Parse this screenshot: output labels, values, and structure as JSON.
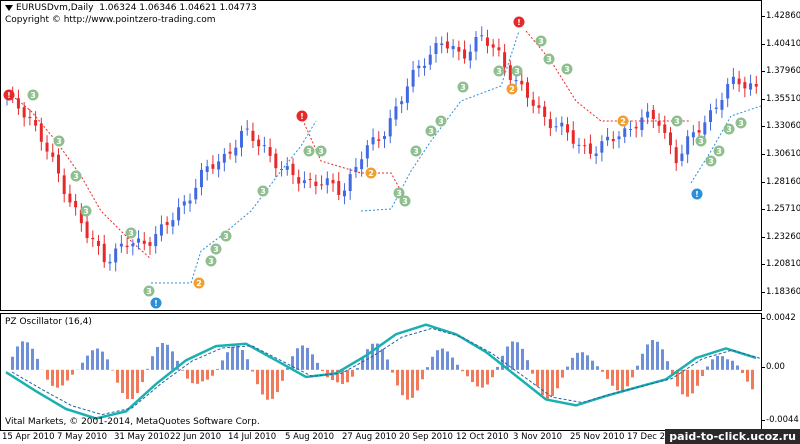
{
  "header": {
    "symbol": "EURUSDvm,Daily",
    "ohlc": "1.06324 1.06346 1.04621 1.04773",
    "copyright": "Copyright © http://www.pointzero-trading.com"
  },
  "main_axis": [
    "1.42860",
    "1.40410",
    "1.37960",
    "1.35510",
    "1.33060",
    "1.30610",
    "1.28160",
    "1.25710",
    "1.23260",
    "1.20810",
    "1.18360"
  ],
  "oscillator": {
    "title": "PZ Oscillator (16,4)",
    "axis": [
      "0.0042",
      "0.00",
      "-0.0044"
    ],
    "footer": "Vital Markets, © 2001-2014, MetaQuotes Software Corp."
  },
  "date_axis": [
    "15 Apr 2010",
    "7 May 2010",
    "31 May 2010",
    "22 Jun 2010",
    "14 Jul 2010",
    "5 Aug 2010",
    "27 Aug 2010",
    "20 Sep 2010",
    "12 Oct 2010",
    "3 Nov 2010",
    "25 Nov 2010",
    "17 Dec 2010"
  ],
  "watermark": "paid-to-click.ucoz.ru",
  "colors": {
    "bull": "#4169e1",
    "bear": "#e8292b",
    "trail_down": "#e8292b",
    "trail_up": "#2b8fd9",
    "marker_red": "#e8292b",
    "marker_blue": "#2b8fd9",
    "marker_orange": "#f0a030",
    "marker_green": "#8fbf8f",
    "osc_line": "#1ab0b0",
    "osc_pos": "#6f8fd8",
    "osc_neg": "#f07a5a"
  },
  "markers": {
    "sell": "!",
    "buy": "!",
    "wave2": "2",
    "wave3": "3"
  },
  "chart_data": {
    "type": "candlestick",
    "x": [
      "15 Apr 2010",
      "7 May 2010",
      "31 May 2010",
      "22 Jun 2010",
      "14 Jul 2010",
      "5 Aug 2010",
      "27 Aug 2010",
      "20 Sep 2010",
      "12 Oct 2010",
      "3 Nov 2010",
      "25 Nov 2010",
      "17 Dec 2010"
    ],
    "close_path": [
      1.355,
      1.345,
      1.31,
      1.275,
      1.235,
      1.215,
      1.225,
      1.23,
      1.24,
      1.265,
      1.29,
      1.305,
      1.325,
      1.315,
      1.29,
      1.285,
      1.28,
      1.275,
      1.305,
      1.325,
      1.355,
      1.39,
      1.405,
      1.395,
      1.41,
      1.395,
      1.365,
      1.345,
      1.33,
      1.315,
      1.31,
      1.325,
      1.335,
      1.34,
      1.3,
      1.33,
      1.35,
      1.375,
      1.365
    ],
    "ylim": [
      1.1836,
      1.4286
    ],
    "oscillator": {
      "ylim": [
        -0.0044,
        0.0042
      ],
      "line": [
        -0.0002,
        -0.0018,
        -0.0033,
        -0.0041,
        -0.0035,
        -0.0012,
        0.0008,
        0.002,
        0.0022,
        0.0008,
        -0.0006,
        -0.0003,
        0.0012,
        0.003,
        0.0038,
        0.003,
        0.0015,
        -0.0005,
        -0.0025,
        -0.003,
        -0.0022,
        -0.0015,
        -0.0008,
        0.001,
        0.0018,
        0.001
      ]
    }
  }
}
